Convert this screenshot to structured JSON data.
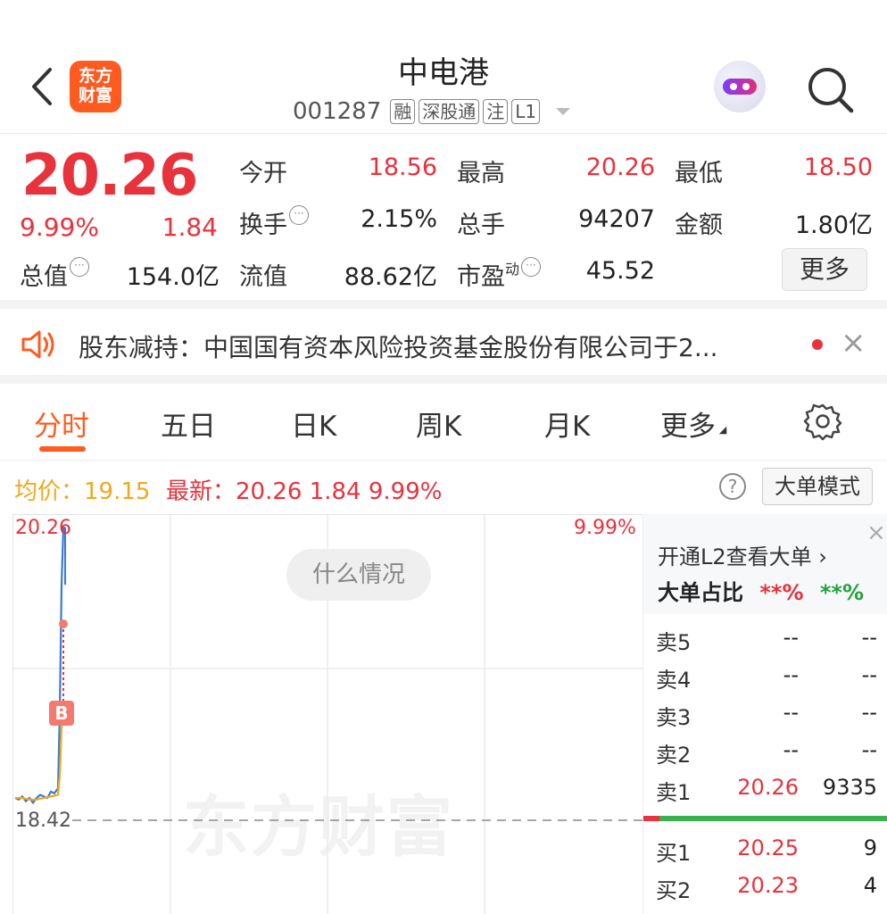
{
  "header": {
    "title": "中电港",
    "code": "001287",
    "tags": [
      "融",
      "深股通",
      "注",
      "L1"
    ],
    "logo_text": [
      "东方",
      "财富"
    ]
  },
  "quote": {
    "price": "20.26",
    "pct": "9.99%",
    "change": "1.84",
    "stats": {
      "open_label": "今开",
      "open": "18.56",
      "high_label": "最高",
      "high": "20.26",
      "low_label": "最低",
      "low": "18.50",
      "turnover_label": "换手",
      "turnover": "2.15%",
      "volume_label": "总手",
      "volume": "94207",
      "amount_label": "金额",
      "amount": "1.80亿",
      "mktcap_label": "总值",
      "mktcap": "154.0亿",
      "float_label": "流值",
      "float": "88.62亿",
      "pe_label": "市盈",
      "pe_sup": "动",
      "pe": "45.52"
    },
    "more_label": "更多"
  },
  "notice": {
    "text": "股东减持：中国国有资本风险投资基金股份有限公司于2..."
  },
  "tabs": [
    {
      "label": "分时"
    },
    {
      "label": "五日"
    },
    {
      "label": "日K"
    },
    {
      "label": "周K"
    },
    {
      "label": "月K"
    },
    {
      "label": "更多"
    }
  ],
  "inforow": {
    "avg": "均价：19.15",
    "latest": "最新：20.26  1.84  9.99%",
    "mode_label": "大单模式",
    "help": "?"
  },
  "chart": {
    "top_price": "20.26",
    "top_pct": "9.99%",
    "base_price": "18.42",
    "bubble": "什么情况",
    "watermark": "东方财富",
    "marker": "B"
  },
  "chart_data": {
    "type": "line",
    "series": [
      {
        "name": "price",
        "x": [
          0,
          2,
          4,
          6,
          8,
          10,
          12,
          14,
          16,
          18,
          20,
          22,
          24,
          25,
          26,
          27,
          28
        ],
        "y": [
          18.56,
          18.55,
          18.57,
          18.54,
          18.56,
          18.53,
          18.56,
          18.58,
          18.57,
          18.56,
          18.6,
          18.59,
          18.62,
          19.1,
          19.9,
          20.26,
          20.26
        ]
      },
      {
        "name": "avg",
        "x": [
          0,
          4,
          8,
          12,
          16,
          20,
          24,
          25,
          26,
          27,
          28
        ],
        "y": [
          18.56,
          18.56,
          18.55,
          18.55,
          18.56,
          18.57,
          18.58,
          18.7,
          19.0,
          19.15,
          19.15
        ]
      }
    ],
    "ylim": [
      18.42,
      20.26
    ]
  },
  "book": {
    "l2_label": "开通L2查看大单 ›",
    "ratio_label": "大单占比",
    "ratio_red": "**%",
    "ratio_green": "**%",
    "asks": [
      {
        "label": "卖5",
        "price": "--",
        "qty": "--"
      },
      {
        "label": "卖4",
        "price": "--",
        "qty": "--"
      },
      {
        "label": "卖3",
        "price": "--",
        "qty": "--"
      },
      {
        "label": "卖2",
        "price": "--",
        "qty": "--"
      },
      {
        "label": "卖1",
        "price": "20.26",
        "qty": "9335"
      }
    ],
    "bids": [
      {
        "label": "买1",
        "price": "20.25",
        "qty": "9"
      },
      {
        "label": "买2",
        "price": "20.23",
        "qty": "4"
      }
    ]
  }
}
